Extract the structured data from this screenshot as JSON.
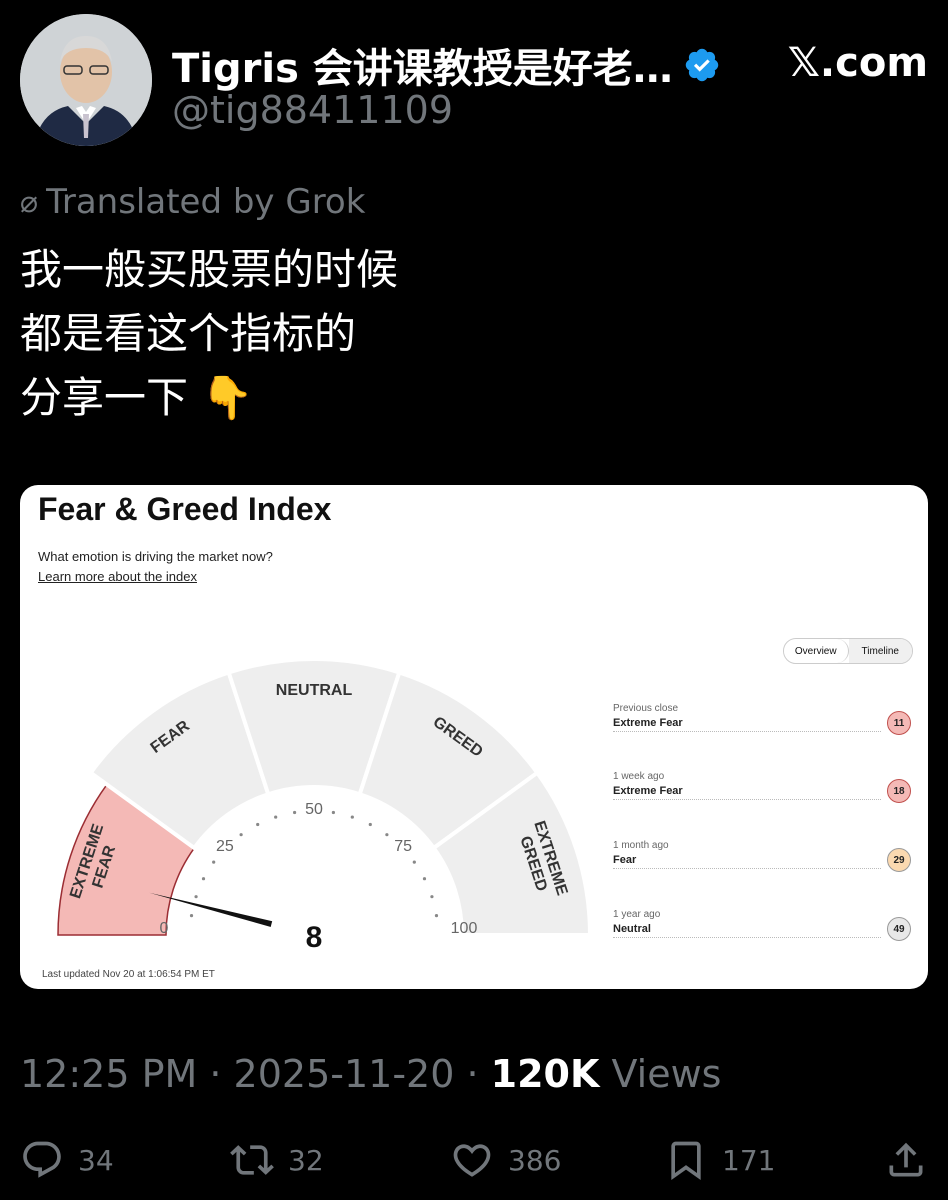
{
  "author": {
    "name": "Tigris 会讲课教授是好老…",
    "handle": "@tig88411109",
    "verified": true
  },
  "site": "𝕏.com",
  "translated_label": "Translated by Grok",
  "tweet_lines": [
    "我一般买股票的时候",
    "都是看这个指标的",
    "分享一下 👇"
  ],
  "card": {
    "title": "Fear & Greed Index",
    "subtitle": "What emotion is driving the market now?",
    "link": "Learn more about the index",
    "toggle": {
      "overview": "Overview",
      "timeline": "Timeline"
    },
    "gauge": {
      "value": 8,
      "value_label": "8",
      "zones": [
        "EXTREME FEAR",
        "FEAR",
        "NEUTRAL",
        "GREED",
        "EXTREME GREED"
      ],
      "active_zone": "EXTREME FEAR",
      "ticks": [
        "0",
        "25",
        "50",
        "75",
        "100"
      ],
      "active_color": "#f4b9b6"
    },
    "history": [
      {
        "when": "Previous close",
        "label": "Extreme Fear",
        "value": "11",
        "color": "#f4b9b6"
      },
      {
        "when": "1 week ago",
        "label": "Extreme Fear",
        "value": "18",
        "color": "#f4b9b6"
      },
      {
        "when": "1 month ago",
        "label": "Fear",
        "value": "29",
        "color": "#fbd9b0"
      },
      {
        "when": "1 year ago",
        "label": "Neutral",
        "value": "49",
        "color": "#e8e8e8"
      }
    ],
    "updated": "Last updated Nov 20 at 1:06:54 PM ET"
  },
  "meta": {
    "time": "12:25 PM",
    "sep": " · ",
    "date": "2025-11-20",
    "views_count": "120K",
    "views_label": " Views"
  },
  "actions": {
    "replies": "34",
    "reposts": "32",
    "likes": "386",
    "bookmarks": "171"
  },
  "colors": {
    "accent": "#1d9bf0",
    "muted": "#71767b"
  }
}
